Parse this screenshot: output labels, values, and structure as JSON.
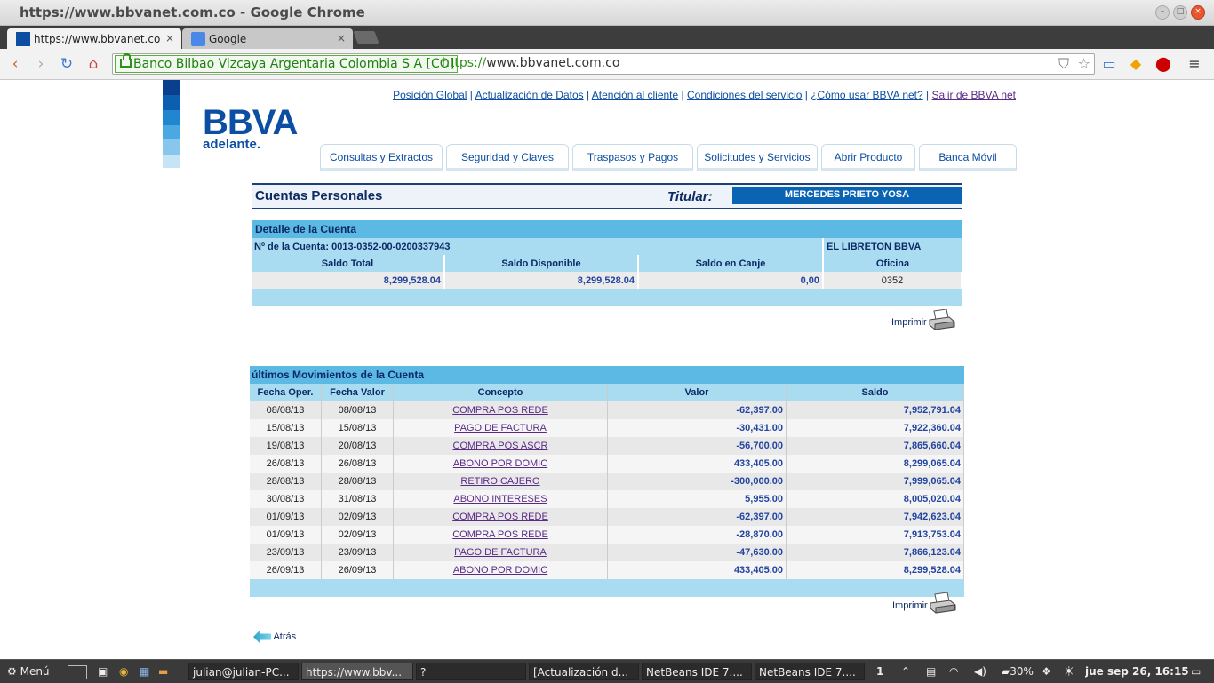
{
  "window": {
    "title": "https://www.bbvanet.com.co - Google Chrome"
  },
  "tabs": [
    {
      "label": "https://www.bbvanet.com.co",
      "active": true
    },
    {
      "label": "Google",
      "active": false
    }
  ],
  "omnibox": {
    "ev_label": "Banco Bilbao Vizcaya Argentaria Colombia S A [CO]",
    "url_scheme": "https://",
    "url_host": "www.bbvanet.com.co"
  },
  "brand": {
    "name": "BBVA",
    "tagline": "adelante.",
    "color": "#0b4ea2"
  },
  "toplinks": [
    "Posición Global",
    "Actualización de Datos",
    "Atención al cliente",
    "Condiciones del servicio",
    "¿Cómo usar BBVA net?",
    "Salir de BBVA net"
  ],
  "menu_tabs": [
    "Consultas y Extractos",
    "Seguridad y Claves",
    "Traspasos y Pagos",
    "Solicitudes y Servicios",
    "Abrir Producto",
    "Banca Móvil"
  ],
  "account_header": {
    "title": "Cuentas Personales",
    "holder_label": "Titular:",
    "holder_name": "MERCEDES PRIETO YOSA"
  },
  "detail": {
    "title": "Detalle de la Cuenta",
    "account_number": "Nº de la Cuenta: 0013-0352-00-0200337943",
    "product": "EL LIBRETON BBVA",
    "headers": [
      "Saldo Total",
      "Saldo Disponible",
      "Saldo en Canje",
      "Oficina"
    ],
    "values": [
      "8,299,528.04",
      "8,299,528.04",
      "0,00",
      "0352"
    ]
  },
  "print_label": "Imprimir",
  "movements": {
    "title": "últimos Movimientos de la Cuenta",
    "headers": [
      "Fecha Oper.",
      "Fecha Valor",
      "Concepto",
      "Valor",
      "Saldo"
    ],
    "rows": [
      [
        "08/08/13",
        "08/08/13",
        "COMPRA POS REDE",
        "-62,397.00",
        "7,952,791.04"
      ],
      [
        "15/08/13",
        "15/08/13",
        "PAGO DE FACTURA",
        "-30,431.00",
        "7,922,360.04"
      ],
      [
        "19/08/13",
        "20/08/13",
        "COMPRA POS ASCR",
        "-56,700.00",
        "7,865,660.04"
      ],
      [
        "26/08/13",
        "26/08/13",
        "ABONO POR DOMIC",
        "433,405.00",
        "8,299,065.04"
      ],
      [
        "28/08/13",
        "28/08/13",
        "RETIRO CAJERO",
        "-300,000.00",
        "7,999,065.04"
      ],
      [
        "30/08/13",
        "31/08/13",
        "ABONO INTERESES",
        "5,955.00",
        "8,005,020.04"
      ],
      [
        "01/09/13",
        "02/09/13",
        "COMPRA POS REDE",
        "-62,397.00",
        "7,942,623.04"
      ],
      [
        "01/09/13",
        "02/09/13",
        "COMPRA POS REDE",
        "-28,870.00",
        "7,913,753.04"
      ],
      [
        "23/09/13",
        "23/09/13",
        "PAGO DE FACTURA",
        "-47,630.00",
        "7,866,123.04"
      ],
      [
        "26/09/13",
        "26/09/13",
        "ABONO POR DOMIC",
        "433,405.00",
        "8,299,528.04"
      ]
    ]
  },
  "back_label": "Atrás",
  "taskbar": {
    "menu_label": "Menú",
    "windows": [
      "julian@julian-PC...",
      "https://www.bbv...",
      "?",
      "[Actualización d...",
      "NetBeans IDE 7....",
      "NetBeans IDE 7...."
    ],
    "tray_badge": "1",
    "battery": "30%",
    "clock": "jue sep 26, 16:15"
  }
}
